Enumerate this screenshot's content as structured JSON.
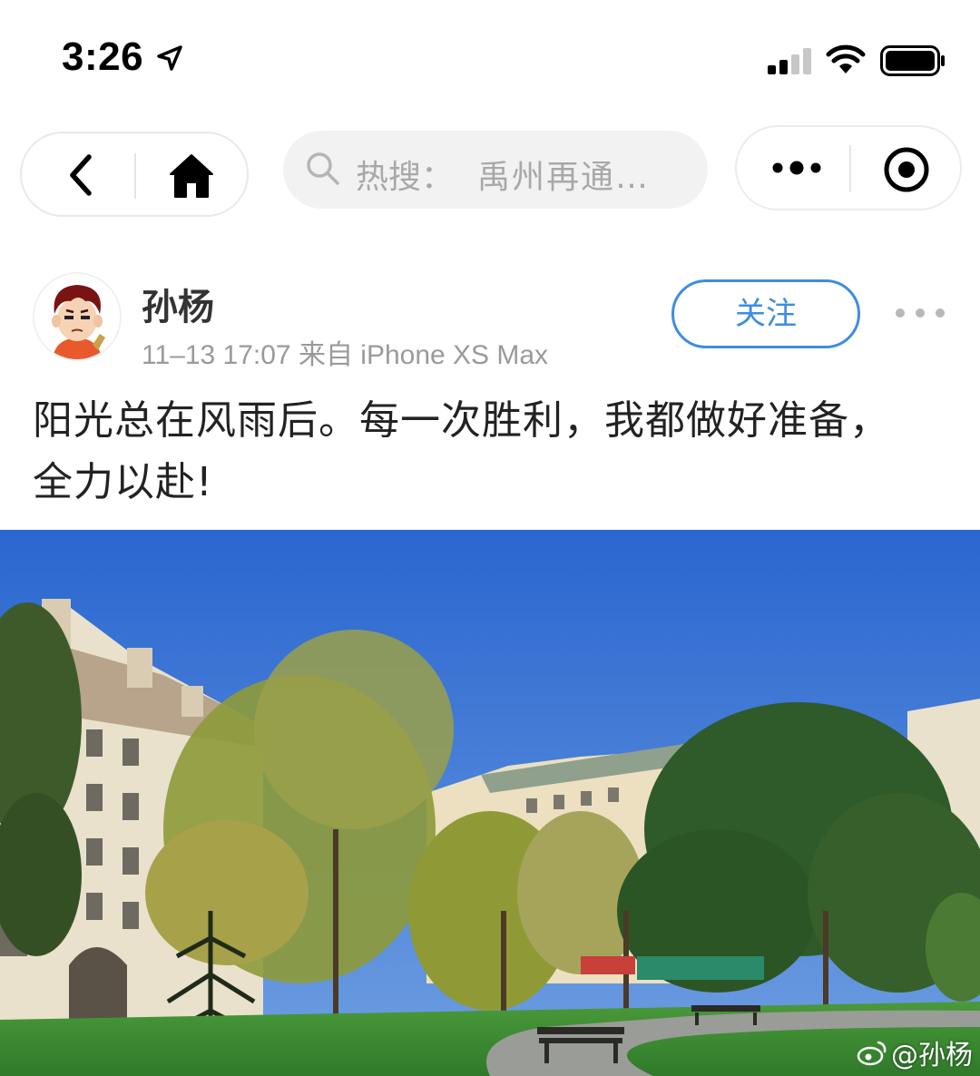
{
  "status_bar": {
    "time": "3:26",
    "icons": [
      "location-arrow-icon",
      "signal-icon",
      "wifi-icon",
      "battery-icon"
    ]
  },
  "nav": {
    "back_icon": "chevron-left-icon",
    "home_icon": "home-icon",
    "search": {
      "prefix": "热搜：",
      "text": "禹州再通…"
    },
    "more_icon": "more-dots-icon",
    "close_icon": "target-close-icon"
  },
  "post": {
    "user_name": "孙杨",
    "meta": "11–13 17:07 来自 iPhone XS Max",
    "follow_label": "关注",
    "text_line1": "阳光总在风雨后。每一次胜利，我都做好准备，",
    "text_line2": "全力以赴!",
    "watermark": "@孙杨"
  },
  "colors": {
    "accent": "#3d8ddf",
    "sky": "#2f6fd4",
    "grass": "#3f8a34",
    "meta_gray": "#9a9a9a"
  }
}
